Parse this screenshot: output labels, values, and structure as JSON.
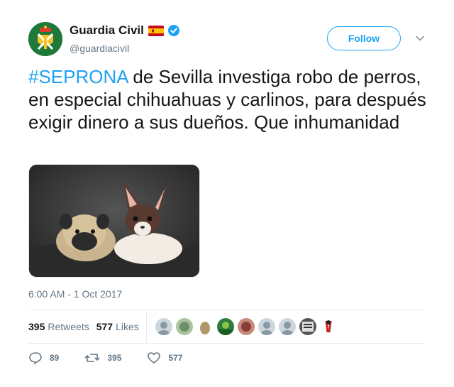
{
  "user": {
    "display_name": "Guardia Civil",
    "handle": "@guardiacivil",
    "verified": true,
    "flag_icon": "spain-flag-icon"
  },
  "follow_label": "Follow",
  "tweet": {
    "hashtag": "#SEPRONA",
    "text": " de Sevilla investiga  robo de perros, en especial chihuahuas y carlinos, para después exigir dinero a sus dueños. Que inhumanidad"
  },
  "timestamp": "6:00 AM - 1 Oct 2017",
  "stats": {
    "retweets_count": "395",
    "retweets_label": "Retweets",
    "likes_count": "577",
    "likes_label": "Likes"
  },
  "actions": {
    "replies": "89",
    "retweets": "395",
    "likes": "577"
  },
  "colors": {
    "accent": "#1da1f2",
    "secondary_text": "#657786",
    "avatar_bg": "#1f7a3a"
  }
}
